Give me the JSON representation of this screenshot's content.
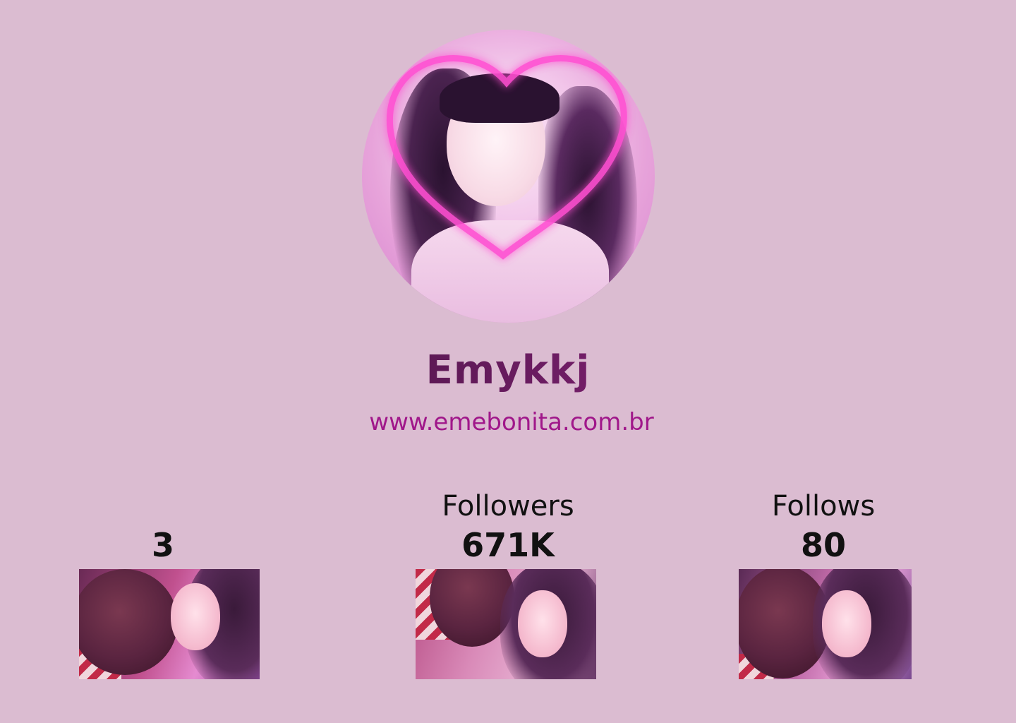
{
  "profile": {
    "username": "Emykkj",
    "website_prefix": "www.",
    "website_rest": "emebonita.com.br"
  },
  "stats": [
    {
      "label": "",
      "value": "3"
    },
    {
      "label": "Followers",
      "value": "671K"
    },
    {
      "label": "Follows",
      "value": "80"
    }
  ],
  "colors": {
    "background": "#dbbcd1",
    "accent": "#a0178a"
  }
}
